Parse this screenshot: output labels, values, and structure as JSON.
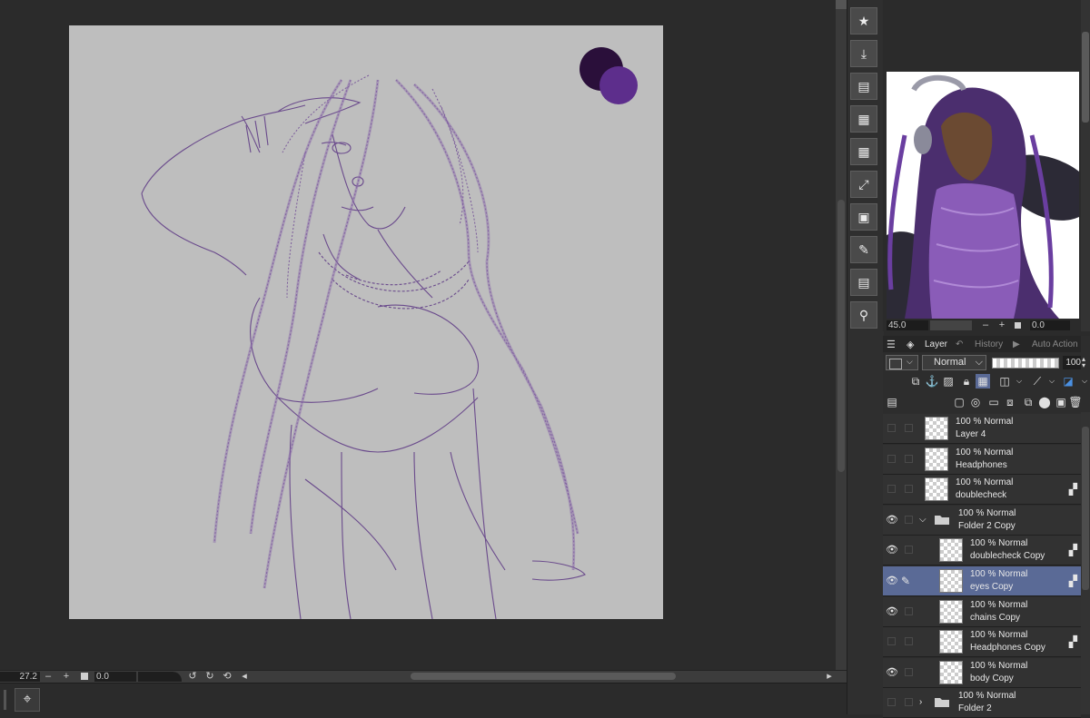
{
  "colors": {
    "canvas_bg": "#bebebe",
    "line_art": "#6a4a8c",
    "swatch_dark": "#2a0f3a",
    "swatch_purple": "#5d2e8c",
    "selected_row": "#5a6a96"
  },
  "tool_buttons": [
    {
      "icon": "star-icon",
      "glyph": "★"
    },
    {
      "icon": "download-icon",
      "glyph": "⤓"
    },
    {
      "icon": "material-icon",
      "glyph": "▤"
    },
    {
      "icon": "grid-icon",
      "glyph": "▦"
    },
    {
      "icon": "grid-alt-icon",
      "glyph": "▦"
    },
    {
      "icon": "transform-icon",
      "glyph": "⤢"
    },
    {
      "icon": "layer-property-icon",
      "glyph": "▣"
    },
    {
      "icon": "edit-icon",
      "glyph": "✎"
    },
    {
      "icon": "tool-property-icon",
      "glyph": "▤"
    },
    {
      "icon": "figure-icon",
      "glyph": "⚲"
    }
  ],
  "status_bar": {
    "zoom": "27.2",
    "minus": "–",
    "plus": "+",
    "angle": "0.0"
  },
  "navigator": {
    "zoom": "45.0",
    "minus": "–",
    "plus": "+",
    "angle": "0.0"
  },
  "layer_panel": {
    "tabs": [
      "Layer",
      "History",
      "Auto Action"
    ],
    "blend_mode": "Normal",
    "opacity": "100"
  },
  "layers": [
    {
      "mode": "100 % Normal",
      "name": "Layer 4",
      "visible": false,
      "reference": false,
      "type": "layer",
      "indent": 0
    },
    {
      "mode": "100 % Normal",
      "name": "Headphones",
      "visible": false,
      "reference": false,
      "type": "layer",
      "indent": 0
    },
    {
      "mode": "100 % Normal",
      "name": "doublecheck",
      "visible": false,
      "reference": true,
      "type": "layer",
      "indent": 0
    },
    {
      "mode": "100 % Normal",
      "name": "Folder 2 Copy",
      "visible": true,
      "reference": false,
      "type": "folder-open",
      "indent": 0
    },
    {
      "mode": "100 % Normal",
      "name": "doublecheck Copy",
      "visible": true,
      "reference": true,
      "type": "layer",
      "indent": 1
    },
    {
      "mode": "100 % Normal",
      "name": "eyes Copy",
      "visible": true,
      "reference": true,
      "type": "layer",
      "indent": 1,
      "selected": true
    },
    {
      "mode": "100 % Normal",
      "name": "chains Copy",
      "visible": true,
      "reference": false,
      "type": "layer",
      "indent": 1
    },
    {
      "mode": "100 % Normal",
      "name": "Headphones Copy",
      "visible": false,
      "reference": true,
      "type": "layer",
      "indent": 1
    },
    {
      "mode": "100 % Normal",
      "name": "body Copy",
      "visible": true,
      "reference": false,
      "type": "layer",
      "indent": 1
    },
    {
      "mode": "100 % Normal",
      "name": "Folder 2",
      "visible": false,
      "reference": false,
      "type": "folder-closed",
      "indent": 0
    }
  ]
}
